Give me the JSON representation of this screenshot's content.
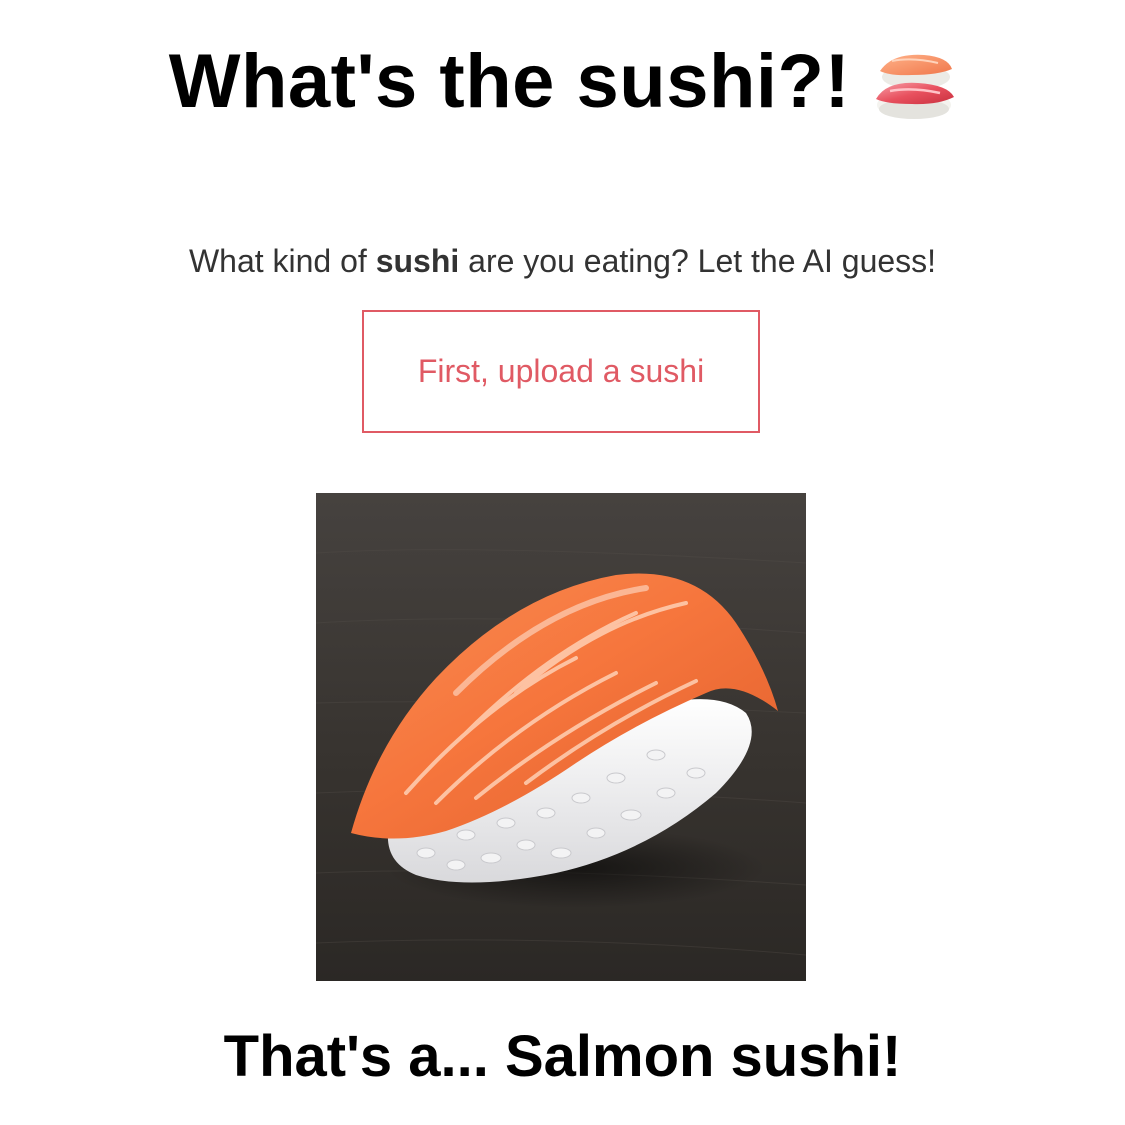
{
  "header": {
    "title": "What's the sushi?!",
    "emoji": "sushi-icon"
  },
  "intro": {
    "text_before": "What kind of ",
    "text_bold": "sushi",
    "text_after": " are you eating? Let the AI guess!"
  },
  "upload": {
    "label": "First, upload a sushi",
    "accent_color": "#e05a64"
  },
  "photo": {
    "subject": "salmon-nigiri-photo"
  },
  "result": {
    "text": "That's a... Salmon sushi!"
  }
}
